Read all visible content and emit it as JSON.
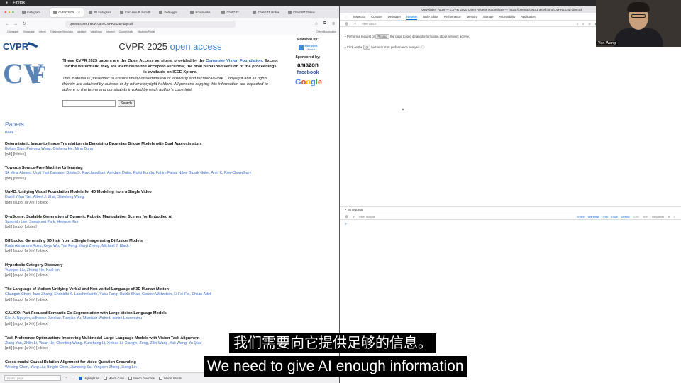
{
  "menubar": {
    "app_name": "Firefox"
  },
  "tabs": [
    {
      "label": "Instagram",
      "active": false
    },
    {
      "label": "CVPR 2025",
      "active": true
    },
    {
      "label": "3D Instagram",
      "active": false
    },
    {
      "label": "Calculate Pi from th",
      "active": false
    },
    {
      "label": "Debugger",
      "active": false
    },
    {
      "label": "Bookmarks",
      "active": false
    },
    {
      "label": "ChatGPT",
      "active": false
    },
    {
      "label": "ChatGPT Online",
      "active": false
    },
    {
      "label": "ChatGPT Online",
      "active": false
    }
  ],
  "url": "openaccess.thecvf.com/CVPR2025?day=all",
  "bookmarks": [
    "Colleague",
    "Showcase",
    "others",
    "Telescope Simulator",
    "website",
    "ValidStack",
    "stonepi",
    "GoodsWorld",
    "Students Portal"
  ],
  "bookmarks_right": "Other Bookmarks",
  "header": {
    "title_main": "CVPR 2025",
    "title_accent": "open access"
  },
  "intro": {
    "bold_prefix": "These CVPR 2025 papers are the Open Access versions, provided by the",
    "bold_link": "Computer Vision Foundation.",
    "bold_suffix": "Except for the watermark, they are identical to the accepted versions; the final published version of the proceedings is available on IEEE Xplore.",
    "italic": "This material is presented to ensure timely dissemination of scholarly and technical work. Copyright and all rights therein are retained by authors or by other copyright holders. All persons copying this information are expected to adhere to the terms and constraints invoked by each author's copyright."
  },
  "sponsors": {
    "powered_by": "Powered by:",
    "ms_line1": "Microsoft",
    "ms_line2": "Azure",
    "sponsored_by": "Sponsored by:",
    "amazon": "amazon",
    "facebook": "facebook"
  },
  "search": {
    "button": "Search",
    "placeholder": ""
  },
  "papers_heading": "Papers",
  "back": "Back",
  "papers": [
    {
      "title": "Deterministic Image-to-Image Translation via Denoising Brownian Bridge Models with Dual Approximators",
      "authors": "Bohan Xiao, Peiyong Wang, Qisheng He, Ming Dong",
      "links": "[pdf] [bibtex]"
    },
    {
      "title": "Towards Source-Free Machine Unlearning",
      "authors": "Sk Miraj Ahmed, Umit Yigit Basaran, Dripta S. Raychaudhuri, Arindam Dutta, Rohit Kundu, Fahim Faisal Niloy, Basak Guler, Amit K. Roy-Chowdhury",
      "links": "[pdf] [bibtex]"
    },
    {
      "title": "Uni4D: Unifying Visual Foundation Models for 4D Modeling from a Single Video",
      "authors": "David Yifan Yao, Albert J. Zhai, Shenlong Wang",
      "links": "[pdf] [supp] [arXiv] [bibtex]"
    },
    {
      "title": "DynScene: Scalable Generation of Dynamic Robotic Manipulation Scenes for Embodied AI",
      "authors": "Sangmin Lee, Sungyong Park, Heewon Kim",
      "links": "[pdf] [supp] [bibtex]"
    },
    {
      "title": "DiffLocks: Generating 3D Hair from a Single Image using Diffusion Models",
      "authors": "Radu Alexandru Rosu, Keyu Wu, Yao Feng, Youyi Zheng, Michael J. Black",
      "links": "[pdf] [supp] [arXiv] [bibtex]"
    },
    {
      "title": "Hyperbolic Category Discovery",
      "authors": "Yuanpei Liu, Zhenqi He, Kai Han",
      "links": "[pdf] [supp] [arXiv] [bibtex]"
    },
    {
      "title": "The Language of Motion: Unifying Verbal and Non-verbal Language of 3D Human Motion",
      "authors": "Changan Chen, Juze Zhang, Shrinidhi K. Lakshmikanth, Yusu Fang, Ruizhi Shao, Gordon Wetzstein, Li Fei-Fei, Ehsan Adeli",
      "links": "[pdf] [supp] [arXiv] [bibtex]"
    },
    {
      "title": "CALICO: Part-Focused Semantic Co-Segmentation with Large Vision-Language Models",
      "authors": "Kiet A. Nguyen, Adheesh Juvekar, Tianjiao Yu, Muntasir Wahed, Ismini Lourentzou",
      "links": "[pdf] [supp] [arXiv] [bibtex]"
    },
    {
      "title": "Task Preference Optimization: Improving Multimodal Large Language Models with Vision Task Alignment",
      "authors": "Ziang Yan, Zhilin Li, Yinan He, Chenting Wang, Kunchang Li, Xinhao Li, Xiangyu Zeng, Zilei Wang, Yali Wang, Yu Qiao",
      "links": "[pdf] [supp] [arXiv] [bibtex]"
    },
    {
      "title": "Cross-modal Causal Relation Alignment for Video Question Grounding",
      "authors": "Weixing Chen, Yang Liu, Binglin Chen, Jiandong Su, Yongsen Zheng, Liang Lin",
      "links": ""
    }
  ],
  "findbar": {
    "placeholder": "Find in page",
    "opt1": "Highlight All",
    "opt2": "Match Case",
    "opt3": "Match Diacritics",
    "opt4": "Whole Words"
  },
  "devtools": {
    "title": "Developer Tools — CVPR 2025 Open Access Repository — https://openaccess.thecvf.com/CVPR2025?day=all",
    "tabs": [
      "Inspector",
      "Console",
      "Debugger",
      "Network",
      "Style Editor",
      "Performance",
      "Memory",
      "Storage",
      "Accessibility",
      "Application"
    ],
    "active_tab": "Network",
    "filter_placeholder": "Filter URLs",
    "types": [
      "All",
      "HTML",
      "CSS",
      "JS",
      "XHR",
      "Fonts",
      "Images",
      "Media"
    ],
    "msg1_pre": "Perform a request or",
    "msg1_btn": "Reload",
    "msg1_post": "the page to see detailed information about network activity.",
    "msg2_pre": "Click on the",
    "msg2_post": "button to start performance analysis.",
    "status": "No requests",
    "console_filter": "Filter Output",
    "console_levels": [
      "Errors",
      "Warnings",
      "Info",
      "Logs",
      "Debug"
    ],
    "console_right": [
      "CSS",
      "XHR",
      "Requests"
    ],
    "prompt": "»"
  },
  "webcam": {
    "name": "Yan Wang"
  },
  "subtitles": {
    "zh": "我们需要向它提供足够的信息。",
    "en": "We need to give AI enough information"
  }
}
